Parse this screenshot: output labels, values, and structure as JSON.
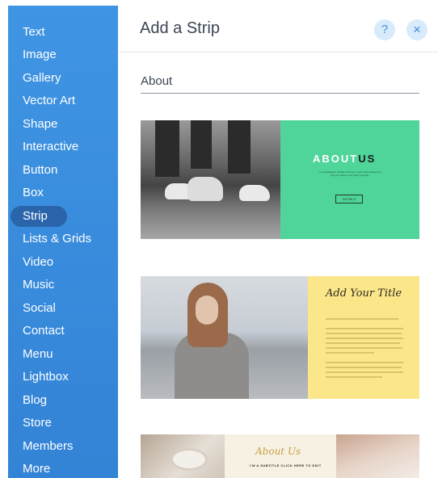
{
  "panel": {
    "title": "Add a Strip",
    "help_label": "?",
    "close_label": "×"
  },
  "sidebar": {
    "active": "Strip",
    "items": [
      {
        "label": "Text"
      },
      {
        "label": "Image"
      },
      {
        "label": "Gallery"
      },
      {
        "label": "Vector Art"
      },
      {
        "label": "Shape"
      },
      {
        "label": "Interactive"
      },
      {
        "label": "Button"
      },
      {
        "label": "Box"
      },
      {
        "label": "Strip"
      },
      {
        "label": "Lists & Grids"
      },
      {
        "label": "Video"
      },
      {
        "label": "Music"
      },
      {
        "label": "Social"
      },
      {
        "label": "Contact"
      },
      {
        "label": "Menu"
      },
      {
        "label": "Lightbox"
      },
      {
        "label": "Blog"
      },
      {
        "label": "Store"
      },
      {
        "label": "Members"
      },
      {
        "label": "More"
      }
    ]
  },
  "section": {
    "label": "About"
  },
  "strips": [
    {
      "heading_part1": "ABOUT",
      "heading_part2": "US",
      "paragraph": "I'm a paragraph. Double click here or just start editing and tell your visitors a bit about yourself.",
      "button_label": "DETAILS",
      "accent_color": "#4fd49a"
    },
    {
      "title": "Add Your Title",
      "accent_color": "#fbe78a"
    },
    {
      "script_title": "About Us",
      "subtitle": "I'M A SUBTITLE CLICK HERE TO EDIT",
      "accent_color": "#f7f1e4"
    }
  ],
  "colors": {
    "sidebar": "#3a8ddf",
    "sidebar_active": "#2a65ab",
    "button_bg": "#d8ebfb",
    "button_fg": "#3a8fe0"
  },
  "icons": {
    "help": "question-icon",
    "close": "close-icon"
  }
}
